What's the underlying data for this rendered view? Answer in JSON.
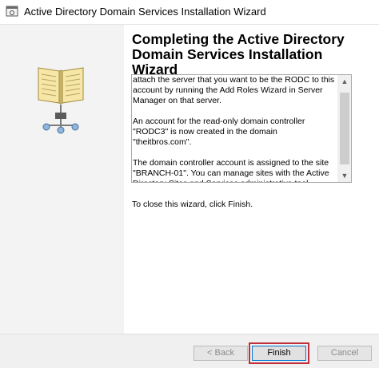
{
  "window": {
    "title": "Active Directory Domain Services Installation Wizard",
    "app_icon": "wizard-app-icon"
  },
  "sidebar": {
    "illustration": "open-book-network-icon"
  },
  "main": {
    "heading_lines": [
      "Completing the Active Directory",
      "Domain Services Installation",
      "Wizard"
    ],
    "summary": {
      "paragraphs": [
        "attach the server that you want to be the RODC to this account by running the Add Roles Wizard in Server Manager on that server.",
        "An account for the read-only domain controller \"RODC3\" is now created in the domain \"theitbros.com\".",
        "The domain controller account is assigned to the site \"BRANCH-01\". You can manage sites with the Active Directory Sites and Services administrative tool."
      ]
    },
    "close_instruction": "To close this wizard, click Finish."
  },
  "footer": {
    "back_label": "< Back",
    "finish_label": "Finish",
    "cancel_label": "Cancel"
  },
  "colors": {
    "highlight": "#c0303a",
    "focus_border": "#0078d7",
    "sidebar_bg": "#f3f3f3",
    "footer_bg": "#f0f0f0"
  }
}
